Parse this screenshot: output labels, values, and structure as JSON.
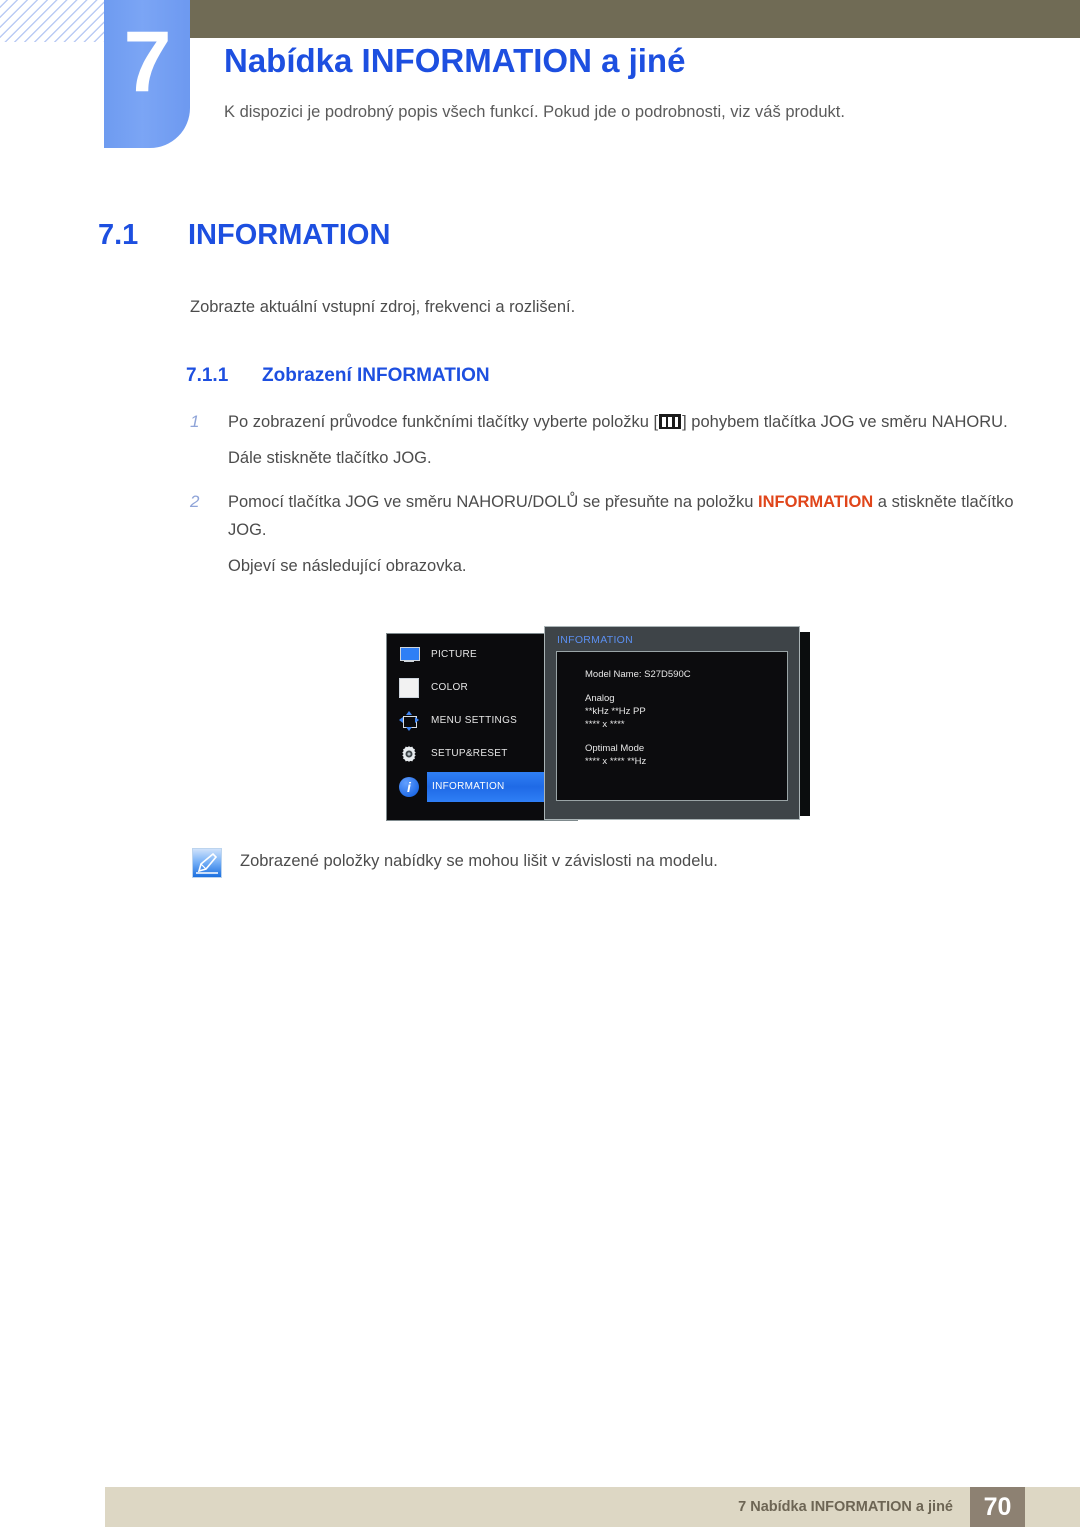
{
  "header": {
    "chapter_number": "7",
    "chapter_title": "Nabídka INFORMATION a jiné",
    "chapter_subtitle": "K dispozici je podrobný popis všech funkcí. Pokud jde o podrobnosti, viz váš produkt.",
    "accent_color": "#1d4fe0",
    "tab_color": "#7ba5f5",
    "bar_color": "#706b55"
  },
  "section": {
    "h1_number": "7.1",
    "h1_title": "INFORMATION",
    "lead": "Zobrazte aktuální vstupní zdroj, frekvenci a rozlišení.",
    "h2_number": "7.1.1",
    "h2_title": "Zobrazení INFORMATION"
  },
  "steps": [
    {
      "number": "1",
      "text_before_icon": "Po zobrazení průvodce funkčními tlačítky vyberte položku [",
      "icon": "menu-bars-icon",
      "text_after_icon": "] pohybem tlačítka JOG ve směru NAHORU.",
      "extra": "Dále stiskněte tlačítko JOG."
    },
    {
      "number": "2",
      "text_before_highlight": "Pomocí tlačítka JOG ve směru NAHORU/DOLŮ se přesuňte na položku ",
      "highlight": "INFORMATION",
      "highlight_color": "#e0451a",
      "text_after_highlight": " a stiskněte tlačítko JOG.",
      "extra": "Objeví se následující obrazovka."
    }
  ],
  "osd": {
    "menu_items": [
      {
        "label": "PICTURE",
        "icon": "monitor-icon",
        "selected": false
      },
      {
        "label": "COLOR",
        "icon": "color-palette-icon",
        "selected": false
      },
      {
        "label": "MENU SETTINGS",
        "icon": "four-arrows-icon",
        "selected": false
      },
      {
        "label": "SETUP&RESET",
        "icon": "gear-icon",
        "selected": false
      },
      {
        "label": "INFORMATION",
        "icon": "info-circle-icon",
        "selected": true
      }
    ],
    "panel_title": "INFORMATION",
    "info": {
      "model_line": "Model Name: S27D590C",
      "source": "Analog",
      "freq": "**kHz **Hz PP",
      "resolution": "**** x ****",
      "optimal_label": "Optimal Mode",
      "optimal_value": "**** x **** **Hz"
    },
    "highlight_color": "#2f7ff5",
    "title_color": "#5b8ff0"
  },
  "note": {
    "icon": "note-pen-icon",
    "text": "Zobrazené položky nabídky se mohou lišit v závislosti na modelu."
  },
  "footer": {
    "text": "7 Nabídka INFORMATION a jiné",
    "page_number": "70",
    "bar_color": "#ddd7c4",
    "page_box_color": "#8d8172"
  }
}
